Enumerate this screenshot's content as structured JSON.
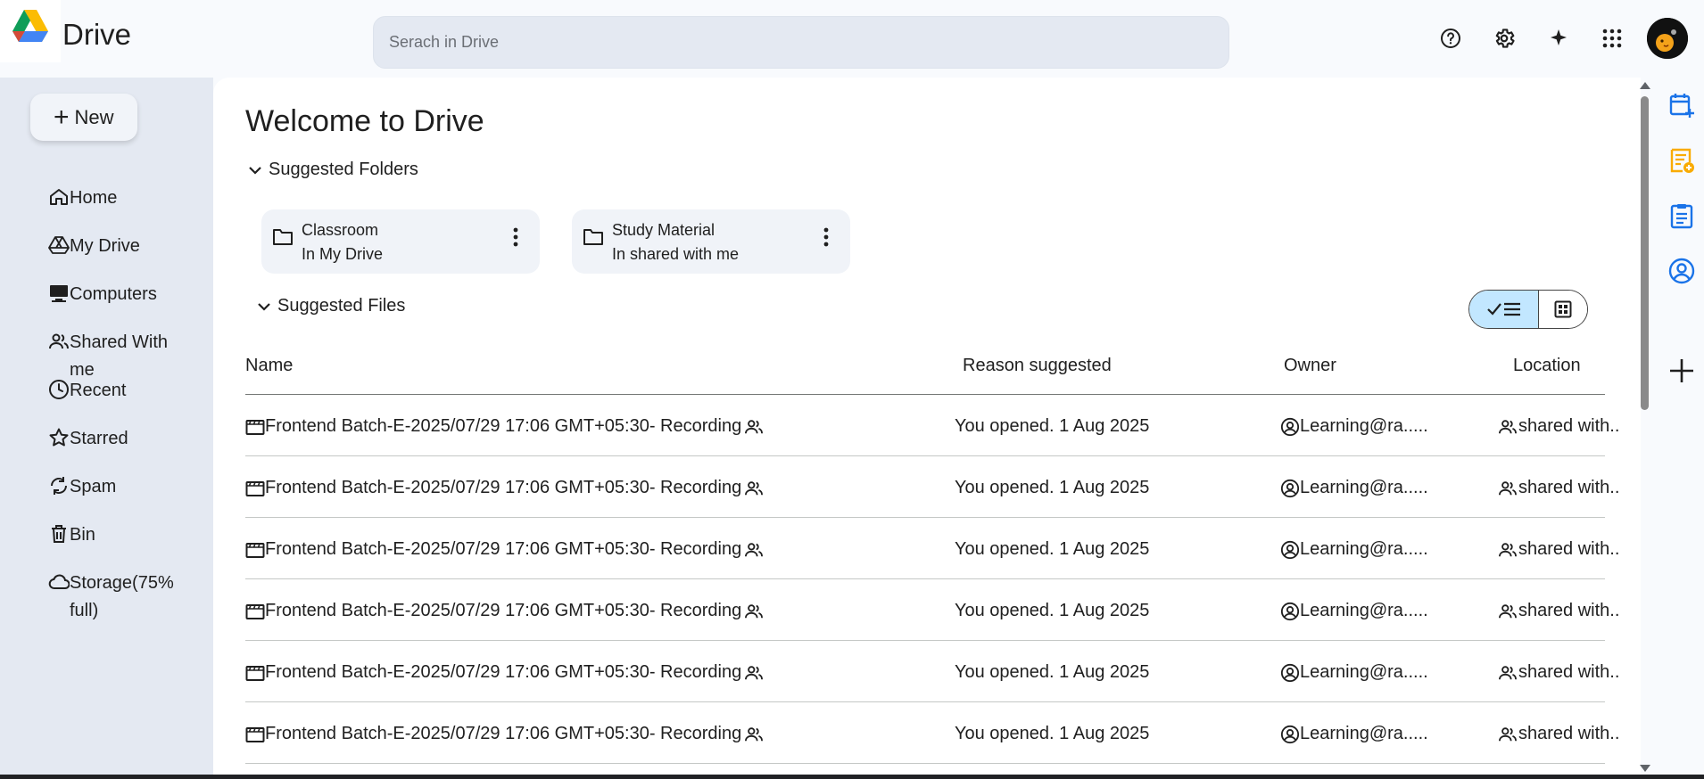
{
  "app": {
    "title": "Drive"
  },
  "search": {
    "placeholder": "Serach in Drive"
  },
  "header_icons": [
    "help-icon",
    "settings-icon",
    "sparkle-icon",
    "apps-grid-icon"
  ],
  "sidebar": {
    "new_label": "New",
    "items": [
      {
        "label": "Home",
        "icon": "home-icon"
      },
      {
        "label": "My Drive",
        "icon": "my-drive-icon"
      },
      {
        "label": "Computers",
        "icon": "computer-icon"
      },
      {
        "label": "Shared With me",
        "icon": "shared-icon"
      },
      {
        "label": "Recent",
        "icon": "clock-icon"
      },
      {
        "label": "Starred",
        "icon": "star-icon"
      },
      {
        "label": "Spam",
        "icon": "spam-icon"
      },
      {
        "label": "Bin",
        "icon": "trash-icon"
      },
      {
        "label": "Storage(75% full)",
        "icon": "cloud-icon"
      }
    ]
  },
  "main": {
    "welcome": "Welcome to Drive",
    "suggested_folders_label": "Suggested Folders",
    "folders": [
      {
        "name": "Classroom",
        "location": "In My Drive"
      },
      {
        "name": "Study Material",
        "location": "In shared with me"
      }
    ],
    "suggested_files_label": "Suggested Files",
    "view_mode": "list",
    "columns": {
      "name": "Name",
      "reason": "Reason suggested",
      "owner": "Owner",
      "location": "Location"
    },
    "files": [
      {
        "name": "Frontend Batch-E-2025/07/29 17:06 GMT+05:30- Recording",
        "reason": "You opened. 1 Aug 2025",
        "owner": "Learning@ra.....",
        "location": "shared with.."
      },
      {
        "name": "Frontend Batch-E-2025/07/29 17:06 GMT+05:30- Recording",
        "reason": "You opened. 1 Aug 2025",
        "owner": "Learning@ra.....",
        "location": "shared with.."
      },
      {
        "name": "Frontend Batch-E-2025/07/29 17:06 GMT+05:30- Recording",
        "reason": "You opened. 1 Aug 2025",
        "owner": "Learning@ra.....",
        "location": "shared with.."
      },
      {
        "name": "Frontend Batch-E-2025/07/29 17:06 GMT+05:30- Recording",
        "reason": "You opened. 1 Aug 2025",
        "owner": "Learning@ra.....",
        "location": "shared with.."
      },
      {
        "name": "Frontend Batch-E-2025/07/29 17:06 GMT+05:30- Recording",
        "reason": "You opened. 1 Aug 2025",
        "owner": "Learning@ra.....",
        "location": "shared with.."
      },
      {
        "name": "Frontend Batch-E-2025/07/29 17:06 GMT+05:30- Recording",
        "reason": "You opened. 1 Aug 2025",
        "owner": "Learning@ra.....",
        "location": "shared with.."
      }
    ]
  },
  "side_panel_icons": [
    "calendar-add-icon",
    "keep-notes-icon",
    "tasks-icon",
    "contacts-icon",
    "add-panel-icon"
  ],
  "colors": {
    "accent": "#0b57d0",
    "selected_view": "#c2e7ff",
    "sidebar_bg": "#e4e9f2",
    "keep_yellow": "#fbbc04"
  }
}
